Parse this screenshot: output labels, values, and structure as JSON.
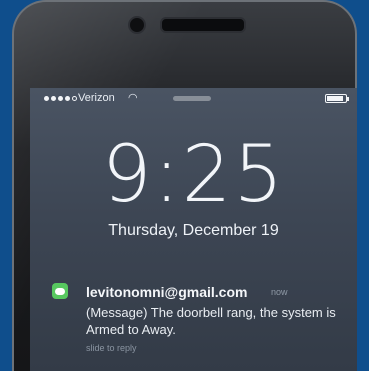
{
  "status": {
    "carrier": "Verizon",
    "wifi_icon": "wifi-icon",
    "battery_level": 0.9
  },
  "lockscreen": {
    "time": "9:25",
    "date": "Thursday, December 19"
  },
  "notification": {
    "app_icon": "messages-icon",
    "sender": "levitonomni@gmail.com",
    "timestamp": "now",
    "message": "(Message) The doorbell rang, the system is Armed to Away.",
    "action_hint": "slide to reply"
  },
  "colors": {
    "background": "#0f4e8c",
    "messages_green": "#57c85f"
  }
}
